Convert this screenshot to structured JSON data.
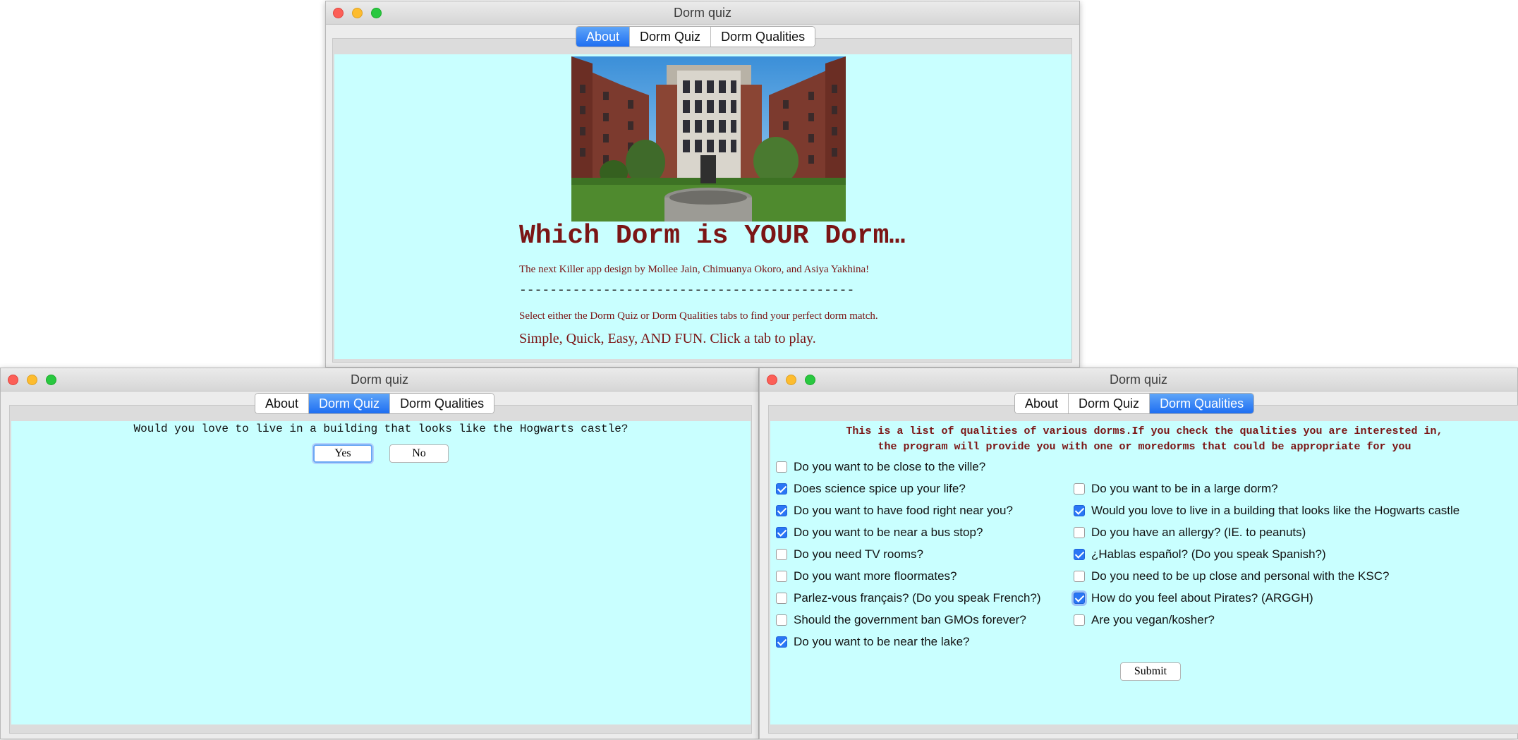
{
  "colors": {
    "content_bg": "#c9ffff",
    "heading_red": "#7b1515",
    "tab_active": "#1e6ef2"
  },
  "windows": {
    "about": {
      "title": "Dorm quiz",
      "tabs": [
        "About",
        "Dorm Quiz",
        "Dorm Qualities"
      ],
      "active_tab": "About",
      "image_description": "photo-icon",
      "heading": "Which Dorm is YOUR Dorm…",
      "credits": "The next Killer app design by Mollee Jain, Chimuanya Okoro, and Asiya Yakhina!",
      "divider": "--------------------------------------------",
      "instructions": "Select either the Dorm Quiz or Dorm Qualities tabs to find your perfect dorm match.",
      "tagline": "Simple, Quick, Easy, AND FUN. Click a tab to play."
    },
    "quiz": {
      "title": "Dorm quiz",
      "tabs": [
        "About",
        "Dorm Quiz",
        "Dorm Qualities"
      ],
      "active_tab": "Dorm Quiz",
      "question": "Would you love to live in a building that looks like the Hogwarts castle?",
      "yes_label": "Yes",
      "no_label": "No"
    },
    "qualities": {
      "title": "Dorm quiz",
      "tabs": [
        "About",
        "Dorm Quiz",
        "Dorm Qualities"
      ],
      "active_tab": "Dorm Qualities",
      "intro_line1": "This is a list of qualities of various dorms.If you check the qualities you are interested in,",
      "intro_line2": "the program will provide you with one or moredorms that could be appropriate for you",
      "left_items": [
        {
          "label": "Do you want to be close to the ville?",
          "checked": false
        },
        {
          "label": "Does science spice up your life?",
          "checked": true
        },
        {
          "label": "Do you want to have food right near you?",
          "checked": true
        },
        {
          "label": "Do you want to be near a bus stop?",
          "checked": true
        },
        {
          "label": "Do you need TV rooms?",
          "checked": false
        },
        {
          "label": "Do you want more floormates?",
          "checked": false
        },
        {
          "label": "Parlez-vous français? (Do you speak French?)",
          "checked": false
        },
        {
          "label": "Should the government ban GMOs forever?",
          "checked": false
        },
        {
          "label": "Do you want to be near the lake?",
          "checked": true
        }
      ],
      "right_items": [
        {
          "label": "Do you want to be in a large dorm?",
          "checked": false
        },
        {
          "label": "Would you love to live in a building that looks like the Hogwarts castle",
          "checked": true
        },
        {
          "label": "Do you have an allergy? (IE. to peanuts)",
          "checked": false
        },
        {
          "label": "¿Hablas español? (Do you speak Spanish?)",
          "checked": true
        },
        {
          "label": "Do you need to be up close and personal with the KSC?",
          "checked": false
        },
        {
          "label": "How do you feel about Pirates? (ARGGH)",
          "checked": true
        },
        {
          "label": "Are you vegan/kosher?",
          "checked": false
        }
      ],
      "submit_label": "Submit"
    }
  }
}
